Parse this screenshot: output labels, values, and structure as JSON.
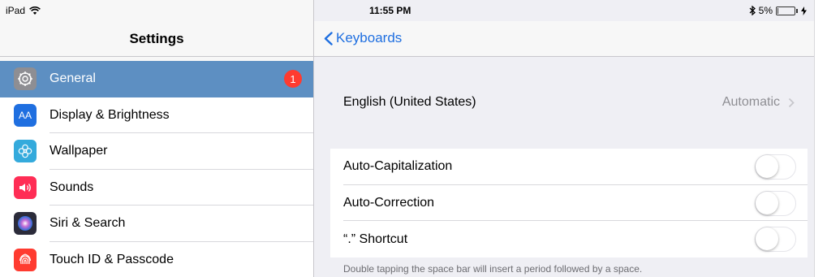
{
  "status_bar": {
    "device": "iPad",
    "time": "11:55 PM",
    "battery_percent": "5%",
    "battery_level": 0.05
  },
  "sidebar": {
    "title": "Settings",
    "items": [
      {
        "label": "General",
        "icon": "gear-icon",
        "color": "#8e8e93",
        "selected": true,
        "badge": "1"
      },
      {
        "label": "Display & Brightness",
        "icon": "display-brightness-icon",
        "color": "#1f6fe0",
        "selected": false
      },
      {
        "label": "Wallpaper",
        "icon": "wallpaper-flower-icon",
        "color": "#34aadc",
        "selected": false
      },
      {
        "label": "Sounds",
        "icon": "speaker-icon",
        "color": "#ff2d55",
        "selected": false
      },
      {
        "label": "Siri & Search",
        "icon": "siri-icon",
        "color": "#2b2b3a",
        "selected": false
      },
      {
        "label": "Touch ID & Passcode",
        "icon": "fingerprint-icon",
        "color": "#ff3b30",
        "selected": false
      }
    ],
    "icon_text": {
      "display": "AA"
    }
  },
  "detail": {
    "back_label": "Keyboards",
    "language_row": {
      "label": "English (United States)",
      "value": "Automatic"
    },
    "toggles": [
      {
        "label": "Auto-Capitalization",
        "on": false
      },
      {
        "label": "Auto-Correction",
        "on": false
      },
      {
        "label": "“.” Shortcut",
        "on": false
      }
    ],
    "footer_note": "Double tapping the space bar will insert a period followed by a space."
  },
  "colors": {
    "accent": "#1f6fe0",
    "selected_row": "#5d8fc2",
    "badge": "#ff3b30"
  }
}
